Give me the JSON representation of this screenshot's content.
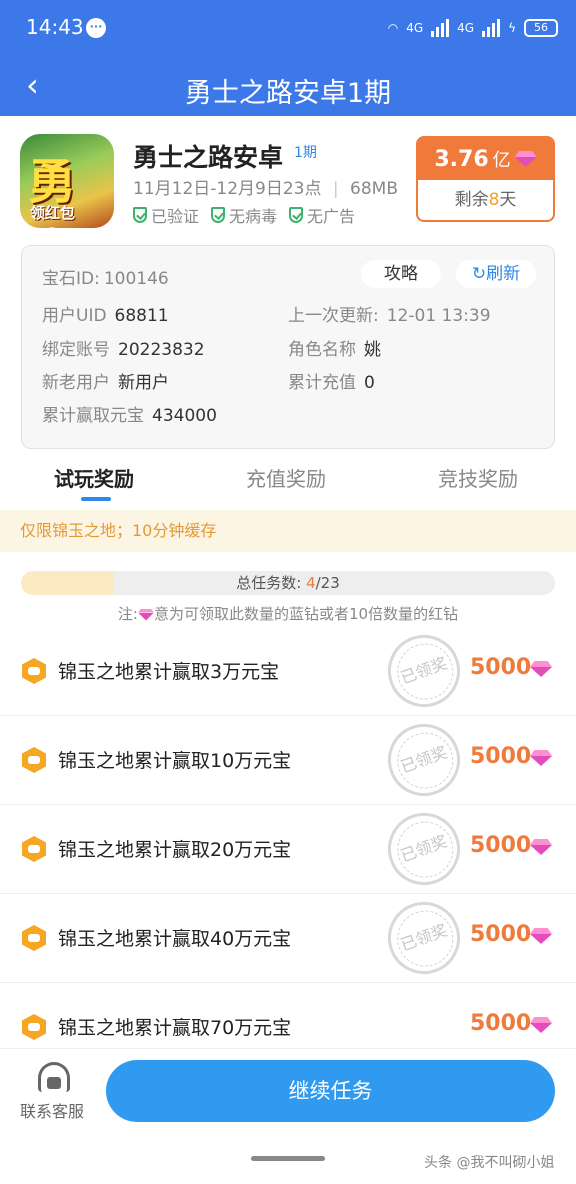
{
  "status_bar": {
    "time": "14:43",
    "net1": "4G",
    "net2": "4G",
    "battery": "56"
  },
  "nav": {
    "title": "勇士之路安卓1期"
  },
  "game": {
    "name": "勇士之路安卓",
    "period": "1期",
    "dates": "11月12日-12月9日23点",
    "size": "68MB",
    "badges": [
      "已验证",
      "无病毒",
      "无广告"
    ],
    "icon_text_big": "勇士",
    "icon_text_small": "领红包"
  },
  "reward": {
    "amount": "3.76",
    "unit": "亿",
    "remain_prefix": "剩余",
    "remain_days": "8",
    "remain_suffix": "天"
  },
  "info": {
    "gem_id_label": "宝石ID:",
    "gem_id": "100146",
    "guide_button": "攻略",
    "refresh_button": "刷新",
    "uid_label": "用户UID",
    "uid": "68811",
    "last_update_label": "上一次更新:",
    "last_update": "12-01 13:39",
    "account_label": "绑定账号",
    "account": "20223832",
    "role_label": "角色名称",
    "role": "姚",
    "user_type_label": "新老用户",
    "user_type": "新用户",
    "recharge_label": "累计充值",
    "recharge": "0",
    "won_label": "累计赢取元宝",
    "won": "434000"
  },
  "tabs": [
    {
      "label": "试玩奖励"
    },
    {
      "label": "充值奖励"
    },
    {
      "label": "竞技奖励"
    }
  ],
  "notice": "仅限锦玉之地；10分钟缓存",
  "progress": {
    "label": "总任务数:",
    "done": "4",
    "total": "/23",
    "fraction": 0.174
  },
  "note": {
    "prefix": "注:",
    "text": "意为可领取此数量的蓝钻或者10倍数量的红钻"
  },
  "tasks": [
    {
      "label": "锦玉之地累计赢取3万元宝",
      "value": "5000",
      "stamp": "已领奖"
    },
    {
      "label": "锦玉之地累计赢取10万元宝",
      "value": "5000",
      "stamp": "已领奖"
    },
    {
      "label": "锦玉之地累计赢取20万元宝",
      "value": "5000",
      "stamp": "已领奖"
    },
    {
      "label": "锦玉之地累计赢取40万元宝",
      "value": "5000",
      "stamp": "已领奖"
    },
    {
      "label": "锦玉之地累计赢取70万元宝",
      "value": "5000",
      "stamp": ""
    }
  ],
  "bottom": {
    "service_label": "联系客服",
    "continue_label": "继续任务"
  },
  "watermark": "头条 @我不叫砌小姐",
  "colors": {
    "primary": "#3d78e8",
    "accent": "#f07a3a",
    "button": "#2f9af0"
  }
}
